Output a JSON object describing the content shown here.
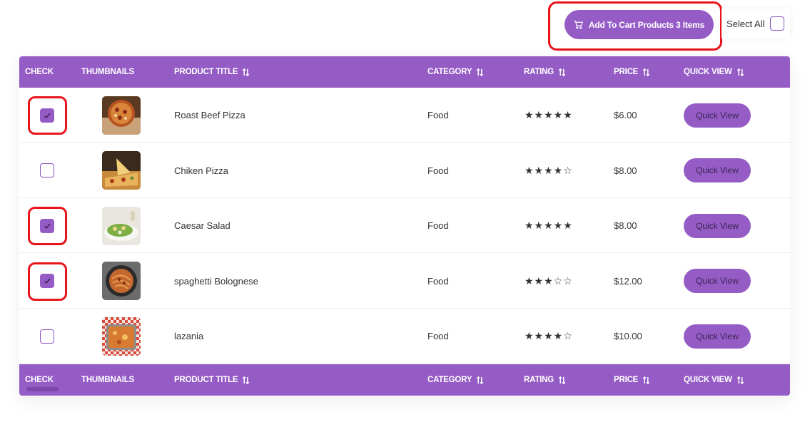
{
  "toolbar": {
    "cart_button_label": "Add To Cart Products 3 Items",
    "cart_icon": "cart-icon",
    "select_all_label": "Select All",
    "select_all_checked": false
  },
  "columns": [
    "CHECK",
    "THUMBNAILS",
    "PRODUCT TITLE",
    "CATEGORY",
    "RATING",
    "PRICE",
    "QUICK VIEW"
  ],
  "sortable": [
    false,
    false,
    true,
    true,
    true,
    true,
    true
  ],
  "products": [
    {
      "checked": true,
      "title": "Roast Beef Pizza",
      "category": "Food",
      "stars": "★★★★★",
      "price": "$6.00",
      "quick_view": "Quick View",
      "thumb": "pizza-top"
    },
    {
      "checked": false,
      "title": "Chiken Pizza",
      "category": "Food",
      "stars": "★★★★☆",
      "price": "$8.00",
      "quick_view": "Quick View",
      "thumb": "pizza-slice"
    },
    {
      "checked": true,
      "title": "Caesar Salad",
      "category": "Food",
      "stars": "★★★★★",
      "price": "$8.00",
      "quick_view": "Quick View",
      "thumb": "salad"
    },
    {
      "checked": true,
      "title": "spaghetti Bolognese",
      "category": "Food",
      "stars": "★★★☆☆",
      "price": "$12.00",
      "quick_view": "Quick View",
      "thumb": "spaghetti"
    },
    {
      "checked": false,
      "title": "lazania",
      "category": "Food",
      "stars": "★★★★☆",
      "price": "$10.00",
      "quick_view": "Quick View",
      "thumb": "lasagna"
    }
  ],
  "colors": {
    "accent": "#955cc6",
    "highlight": "#e8141b"
  }
}
